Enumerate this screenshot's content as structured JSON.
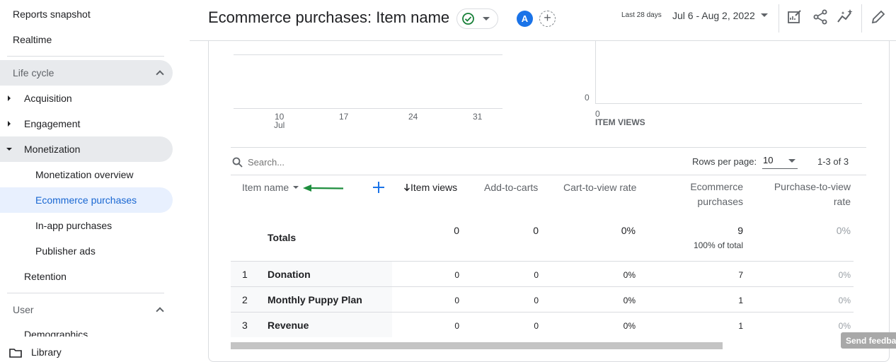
{
  "sidebar": {
    "reports_snapshot": "Reports snapshot",
    "realtime": "Realtime",
    "lifecycle_title": "Life cycle",
    "acquisition": "Acquisition",
    "engagement": "Engagement",
    "monetization": "Monetization",
    "monetization_overview": "Monetization overview",
    "ecommerce_purchases": "Ecommerce purchases",
    "in_app_purchases": "In-app purchases",
    "publisher_ads": "Publisher ads",
    "retention": "Retention",
    "user_title": "User",
    "demographics_partial": "Demographics",
    "library": "Library"
  },
  "header": {
    "title": "Ecommerce purchases: Item name",
    "avatar_letter": "A",
    "date_label": "Last 28 days",
    "date_range": "Jul 6 - Aug 2, 2022"
  },
  "chart_left": {
    "x_ticks": [
      "10",
      "17",
      "24",
      "31"
    ],
    "x_sub": "Jul"
  },
  "chart_right": {
    "y_tick": "0",
    "x_tick": "0",
    "x_label": "ITEM VIEWS"
  },
  "table": {
    "search_placeholder": "Search...",
    "rows_per_page_label": "Rows per page:",
    "rows_per_page_value": "10",
    "pagination": "1-3 of 3",
    "columns": {
      "item_name": "Item name",
      "item_views": "Item views",
      "add_to_carts": "Add-to-carts",
      "cart_to_view_rate": "Cart-to-view rate",
      "ecommerce_purchases_1": "Ecommerce",
      "ecommerce_purchases_2": "purchases",
      "purchase_to_view_1": "Purchase-to-view",
      "purchase_to_view_2": "rate"
    },
    "totals": {
      "label": "Totals",
      "item_views": "0",
      "add_to_carts": "0",
      "cart_to_view_rate": "0%",
      "ecommerce_purchases": "9",
      "ecommerce_purchases_sub": "100% of total",
      "purchase_to_view_rate": "0%"
    },
    "rows": [
      {
        "num": "1",
        "name": "Donation",
        "item_views": "0",
        "add_to_carts": "0",
        "cart_to_view_rate": "0%",
        "ecommerce_purchases": "7",
        "purchase_to_view_rate": "0%"
      },
      {
        "num": "2",
        "name": "Monthly Puppy Plan",
        "item_views": "0",
        "add_to_carts": "0",
        "cart_to_view_rate": "0%",
        "ecommerce_purchases": "1",
        "purchase_to_view_rate": "0%"
      },
      {
        "num": "3",
        "name": "Revenue",
        "item_views": "0",
        "add_to_carts": "0",
        "cart_to_view_rate": "0%",
        "ecommerce_purchases": "1",
        "purchase_to_view_rate": "0%"
      }
    ]
  },
  "feedback": "Send feedback",
  "colors": {
    "accent": "#1a73e8",
    "active_bg": "#e8f0fe",
    "arrow_green": "#1e8e3e",
    "status_green": "#188038"
  },
  "icons": [
    "check-circle-icon",
    "dropdown-caret-icon",
    "plus-icon",
    "edit-report-icon",
    "share-icon",
    "insights-icon",
    "pencil-icon",
    "search-icon",
    "folder-icon",
    "sort-down-arrow-icon"
  ]
}
